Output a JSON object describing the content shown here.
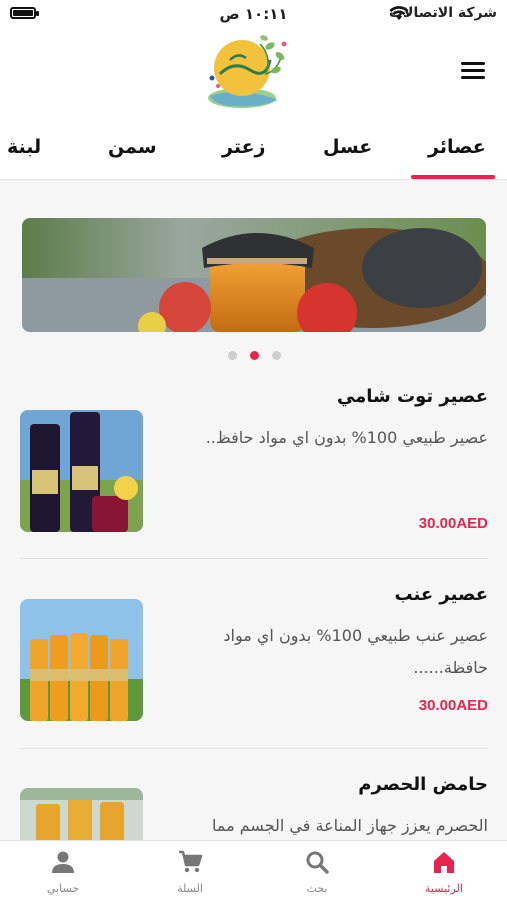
{
  "status_bar": {
    "time": "١٠:١١ ص",
    "carrier": "شركة الاتصالات"
  },
  "header": {
    "logo": "jidi-logo",
    "menu_icon": "hamburger-icon"
  },
  "tabs": [
    {
      "label": "عصائر",
      "active": true
    },
    {
      "label": "عسل",
      "active": false
    },
    {
      "label": "زعتر",
      "active": false
    },
    {
      "label": "سمن",
      "active": false
    },
    {
      "label": "لبنة",
      "active": false
    }
  ],
  "carousel": {
    "slide_count": 3,
    "active_index": 1
  },
  "products": [
    {
      "title": "عصير توت شامي",
      "description": "عصير طبيعي 100% بدون اي مواد حافظ..",
      "price": "30.00AED"
    },
    {
      "title": "عصير عنب",
      "description": "عصير عنب طبيعي 100% بدون اي مواد حافظة......",
      "price": "30.00AED"
    },
    {
      "title": "حامض الحصرم",
      "description": "الحصرم يعزز جهاز المناعة في الجسم مما",
      "price": ""
    }
  ],
  "bottom_nav": [
    {
      "label": "الرئيسية",
      "icon": "home-icon",
      "active": true
    },
    {
      "label": "بحث",
      "icon": "search-icon",
      "active": false
    },
    {
      "label": "السلة",
      "icon": "cart-icon",
      "active": false
    },
    {
      "label": "حسابي",
      "icon": "user-icon",
      "active": false
    }
  ],
  "colors": {
    "accent": "#e8244e",
    "background": "#f6f6f6",
    "text": "#222222"
  }
}
